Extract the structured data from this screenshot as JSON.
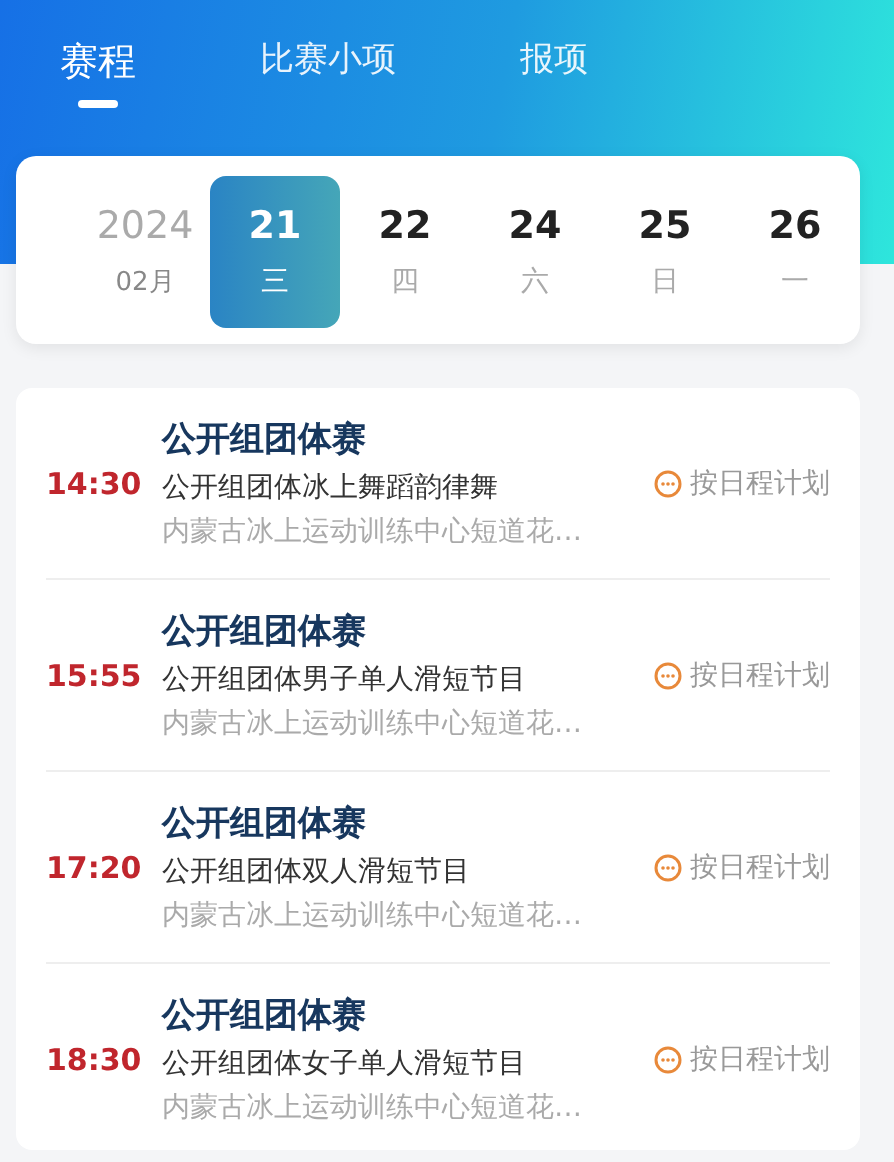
{
  "tabs": [
    {
      "label": "赛程",
      "selected": true
    },
    {
      "label": "比赛小项",
      "selected": false
    },
    {
      "label": "报项",
      "selected": false
    }
  ],
  "date_strip": {
    "year": "2024",
    "month": "02月",
    "days": [
      {
        "date": "21",
        "weekday": "三",
        "selected": true
      },
      {
        "date": "22",
        "weekday": "四",
        "selected": false
      },
      {
        "date": "24",
        "weekday": "六",
        "selected": false
      },
      {
        "date": "25",
        "weekday": "日",
        "selected": false
      },
      {
        "date": "26",
        "weekday": "一",
        "selected": false
      }
    ]
  },
  "events": [
    {
      "time": "14:30",
      "title": "公开组团体赛",
      "event": "公开组团体冰上舞蹈韵律舞",
      "venue": "内蒙古冰上运动训练中心短道花…",
      "status": "按日程计划"
    },
    {
      "time": "15:55",
      "title": "公开组团体赛",
      "event": "公开组团体男子单人滑短节目",
      "venue": "内蒙古冰上运动训练中心短道花…",
      "status": "按日程计划"
    },
    {
      "time": "17:20",
      "title": "公开组团体赛",
      "event": "公开组团体双人滑短节目",
      "venue": "内蒙古冰上运动训练中心短道花…",
      "status": "按日程计划"
    },
    {
      "time": "18:30",
      "title": "公开组团体赛",
      "event": "公开组团体女子单人滑短节目",
      "venue": "内蒙古冰上运动训练中心短道花…",
      "status": "按日程计划"
    }
  ]
}
